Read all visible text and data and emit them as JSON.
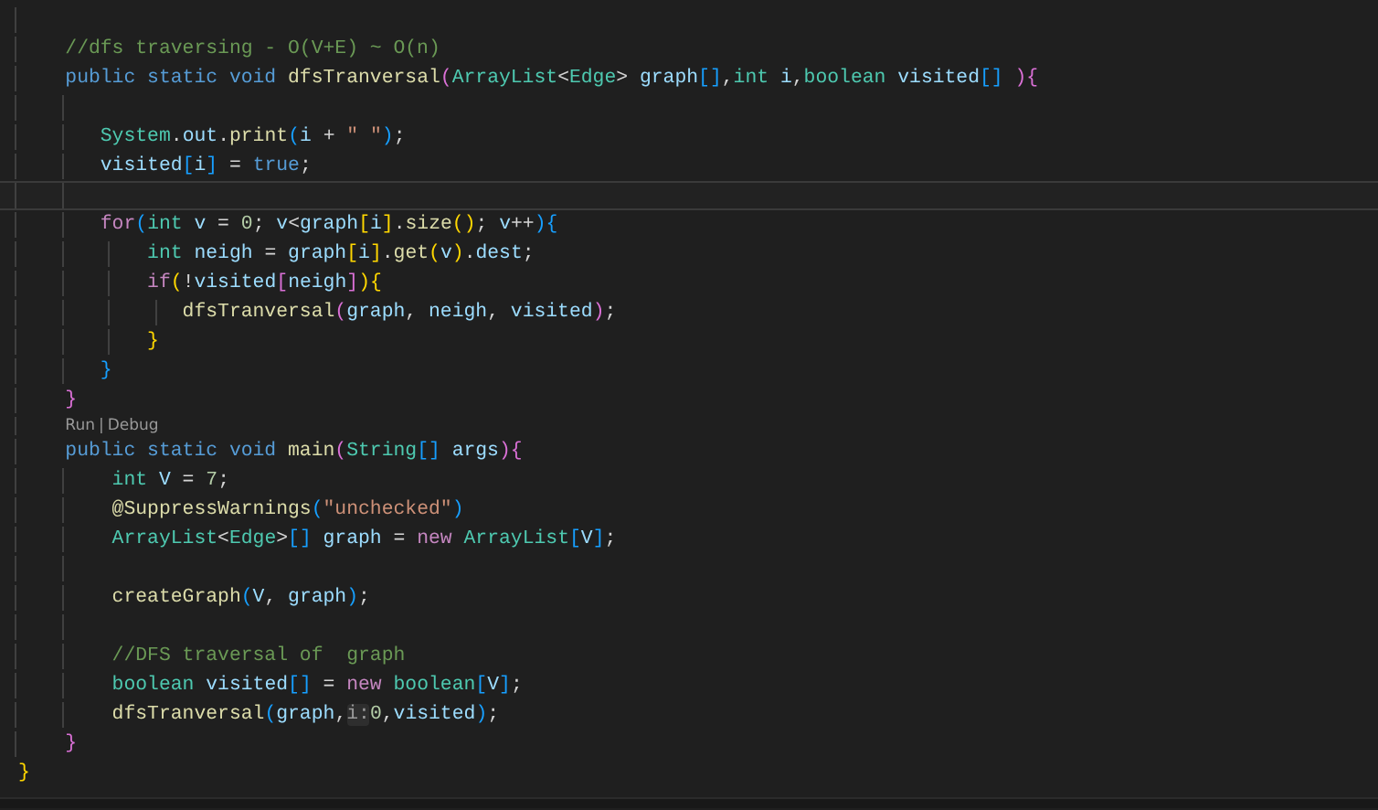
{
  "editor": {
    "lines": [
      {
        "kind": "blank",
        "current": false
      },
      {
        "kind": "code",
        "current": false,
        "tokens": [
          {
            "text": "    //dfs traversing - O(V+E) ~ O(n)",
            "kind": "com"
          }
        ]
      },
      {
        "kind": "code",
        "current": false,
        "tokens": [
          {
            "text": "    public static void ",
            "kind": "kw"
          },
          {
            "text": "dfsTranversal",
            "kind": "fn"
          },
          {
            "text": "(",
            "kind": "b2"
          },
          {
            "text": "ArrayList",
            "kind": "type"
          },
          {
            "text": "<",
            "kind": "p"
          },
          {
            "text": "Edge",
            "kind": "type"
          },
          {
            "text": ">",
            "kind": "p"
          },
          {
            "text": " graph",
            "kind": "var"
          },
          {
            "text": "[]",
            "kind": "b3"
          },
          {
            "text": ",",
            "kind": "p"
          },
          {
            "text": "int",
            "kind": "type"
          },
          {
            "text": " i",
            "kind": "var"
          },
          {
            "text": ",",
            "kind": "p"
          },
          {
            "text": "boolean",
            "kind": "type"
          },
          {
            "text": " visited",
            "kind": "var"
          },
          {
            "text": "[]",
            "kind": "b3"
          },
          {
            "text": " ){",
            "kind": "b2"
          }
        ]
      },
      {
        "kind": "blank",
        "current": false
      },
      {
        "kind": "code",
        "current": false,
        "tokens": [
          {
            "text": "       System",
            "kind": "type"
          },
          {
            "text": ".",
            "kind": "p"
          },
          {
            "text": "out",
            "kind": "var"
          },
          {
            "text": ".",
            "kind": "p"
          },
          {
            "text": "print",
            "kind": "fn"
          },
          {
            "text": "(",
            "kind": "b3"
          },
          {
            "text": "i",
            "kind": "var"
          },
          {
            "text": " + ",
            "kind": "p"
          },
          {
            "text": "\" \"",
            "kind": "str"
          },
          {
            "text": ")",
            "kind": "b3"
          },
          {
            "text": ";",
            "kind": "p"
          }
        ]
      },
      {
        "kind": "code",
        "current": false,
        "tokens": [
          {
            "text": "       visited",
            "kind": "var"
          },
          {
            "text": "[",
            "kind": "b3"
          },
          {
            "text": "i",
            "kind": "var"
          },
          {
            "text": "]",
            "kind": "b3"
          },
          {
            "text": " = ",
            "kind": "p"
          },
          {
            "text": "true",
            "kind": "kw"
          },
          {
            "text": ";",
            "kind": "p"
          }
        ]
      },
      {
        "kind": "blank",
        "current": true
      },
      {
        "kind": "code",
        "current": false,
        "tokens": [
          {
            "text": "       for",
            "kind": "ctl"
          },
          {
            "text": "(",
            "kind": "b3"
          },
          {
            "text": "int",
            "kind": "type"
          },
          {
            "text": " v",
            "kind": "var"
          },
          {
            "text": " = ",
            "kind": "p"
          },
          {
            "text": "0",
            "kind": "num"
          },
          {
            "text": "; ",
            "kind": "p"
          },
          {
            "text": "v",
            "kind": "var"
          },
          {
            "text": "<",
            "kind": "p"
          },
          {
            "text": "graph",
            "kind": "var"
          },
          {
            "text": "[",
            "kind": "b1"
          },
          {
            "text": "i",
            "kind": "var"
          },
          {
            "text": "]",
            "kind": "b1"
          },
          {
            "text": ".",
            "kind": "p"
          },
          {
            "text": "size",
            "kind": "fn"
          },
          {
            "text": "()",
            "kind": "b1"
          },
          {
            "text": "; ",
            "kind": "p"
          },
          {
            "text": "v",
            "kind": "var"
          },
          {
            "text": "++",
            "kind": "p"
          },
          {
            "text": "){",
            "kind": "b3"
          }
        ]
      },
      {
        "kind": "code",
        "current": false,
        "tokens": [
          {
            "text": "           int",
            "kind": "type"
          },
          {
            "text": " neigh",
            "kind": "var"
          },
          {
            "text": " = ",
            "kind": "p"
          },
          {
            "text": "graph",
            "kind": "var"
          },
          {
            "text": "[",
            "kind": "b1"
          },
          {
            "text": "i",
            "kind": "var"
          },
          {
            "text": "]",
            "kind": "b1"
          },
          {
            "text": ".",
            "kind": "p"
          },
          {
            "text": "get",
            "kind": "fn"
          },
          {
            "text": "(",
            "kind": "b1"
          },
          {
            "text": "v",
            "kind": "var"
          },
          {
            "text": ")",
            "kind": "b1"
          },
          {
            "text": ".",
            "kind": "p"
          },
          {
            "text": "dest",
            "kind": "var"
          },
          {
            "text": ";",
            "kind": "p"
          }
        ]
      },
      {
        "kind": "code",
        "current": false,
        "tokens": [
          {
            "text": "           if",
            "kind": "ctl"
          },
          {
            "text": "(",
            "kind": "b1"
          },
          {
            "text": "!",
            "kind": "p"
          },
          {
            "text": "visited",
            "kind": "var"
          },
          {
            "text": "[",
            "kind": "b2"
          },
          {
            "text": "neigh",
            "kind": "var"
          },
          {
            "text": "]",
            "kind": "b2"
          },
          {
            "text": "){",
            "kind": "b1"
          }
        ]
      },
      {
        "kind": "code",
        "current": false,
        "tokens": [
          {
            "text": "              dfsTranversal",
            "kind": "fn"
          },
          {
            "text": "(",
            "kind": "b2"
          },
          {
            "text": "graph",
            "kind": "var"
          },
          {
            "text": ", ",
            "kind": "p"
          },
          {
            "text": "neigh",
            "kind": "var"
          },
          {
            "text": ", ",
            "kind": "p"
          },
          {
            "text": "visited",
            "kind": "var"
          },
          {
            "text": ")",
            "kind": "b2"
          },
          {
            "text": ";",
            "kind": "p"
          }
        ]
      },
      {
        "kind": "code",
        "current": false,
        "tokens": [
          {
            "text": "           }",
            "kind": "b1"
          }
        ]
      },
      {
        "kind": "code",
        "current": false,
        "tokens": [
          {
            "text": "       }",
            "kind": "b3"
          }
        ]
      },
      {
        "kind": "code",
        "current": false,
        "tokens": [
          {
            "text": "    }",
            "kind": "b2"
          }
        ]
      },
      {
        "kind": "codelens",
        "current": false,
        "actions": [
          "Run",
          "Debug"
        ],
        "separator": "|"
      },
      {
        "kind": "code",
        "current": false,
        "tokens": [
          {
            "text": "    public static void ",
            "kind": "kw"
          },
          {
            "text": "main",
            "kind": "fn"
          },
          {
            "text": "(",
            "kind": "b2"
          },
          {
            "text": "String",
            "kind": "type"
          },
          {
            "text": "[]",
            "kind": "b3"
          },
          {
            "text": " args",
            "kind": "var"
          },
          {
            "text": "){",
            "kind": "b2"
          }
        ]
      },
      {
        "kind": "code",
        "current": false,
        "tokens": [
          {
            "text": "        int",
            "kind": "type"
          },
          {
            "text": " V",
            "kind": "var"
          },
          {
            "text": " = ",
            "kind": "p"
          },
          {
            "text": "7",
            "kind": "num"
          },
          {
            "text": ";",
            "kind": "p"
          }
        ]
      },
      {
        "kind": "code",
        "current": false,
        "tokens": [
          {
            "text": "        @SuppressWarnings",
            "kind": "fn"
          },
          {
            "text": "(",
            "kind": "b3"
          },
          {
            "text": "\"unchecked\"",
            "kind": "str"
          },
          {
            "text": ")",
            "kind": "b3"
          }
        ]
      },
      {
        "kind": "code",
        "current": false,
        "tokens": [
          {
            "text": "        ArrayList",
            "kind": "type"
          },
          {
            "text": "<",
            "kind": "p"
          },
          {
            "text": "Edge",
            "kind": "type"
          },
          {
            "text": ">",
            "kind": "p"
          },
          {
            "text": "[]",
            "kind": "b3"
          },
          {
            "text": " graph",
            "kind": "var"
          },
          {
            "text": " = ",
            "kind": "p"
          },
          {
            "text": "new",
            "kind": "ctl"
          },
          {
            "text": " ArrayList",
            "kind": "type"
          },
          {
            "text": "[",
            "kind": "b3"
          },
          {
            "text": "V",
            "kind": "var"
          },
          {
            "text": "]",
            "kind": "b3"
          },
          {
            "text": ";",
            "kind": "p"
          }
        ]
      },
      {
        "kind": "blank",
        "current": false
      },
      {
        "kind": "code",
        "current": false,
        "tokens": [
          {
            "text": "        createGraph",
            "kind": "fn"
          },
          {
            "text": "(",
            "kind": "b3"
          },
          {
            "text": "V",
            "kind": "var"
          },
          {
            "text": ", ",
            "kind": "p"
          },
          {
            "text": "graph",
            "kind": "var"
          },
          {
            "text": ")",
            "kind": "b3"
          },
          {
            "text": ";",
            "kind": "p"
          }
        ]
      },
      {
        "kind": "blank",
        "current": false
      },
      {
        "kind": "code",
        "current": false,
        "tokens": [
          {
            "text": "        //DFS traversal of  graph",
            "kind": "com"
          }
        ]
      },
      {
        "kind": "code",
        "current": false,
        "tokens": [
          {
            "text": "        boolean",
            "kind": "type"
          },
          {
            "text": " visited",
            "kind": "var"
          },
          {
            "text": "[]",
            "kind": "b3"
          },
          {
            "text": " = ",
            "kind": "p"
          },
          {
            "text": "new",
            "kind": "ctl"
          },
          {
            "text": " boolean",
            "kind": "type"
          },
          {
            "text": "[",
            "kind": "b3"
          },
          {
            "text": "V",
            "kind": "var"
          },
          {
            "text": "]",
            "kind": "b3"
          },
          {
            "text": ";",
            "kind": "p"
          }
        ]
      },
      {
        "kind": "code",
        "current": false,
        "tokens": [
          {
            "text": "        dfsTranversal",
            "kind": "fn"
          },
          {
            "text": "(",
            "kind": "b3"
          },
          {
            "text": "graph",
            "kind": "var"
          },
          {
            "text": ",",
            "kind": "p"
          },
          {
            "text": "i:",
            "kind": "hint"
          },
          {
            "text": "0",
            "kind": "num"
          },
          {
            "text": ",",
            "kind": "p"
          },
          {
            "text": "visited",
            "kind": "var"
          },
          {
            "text": ")",
            "kind": "b3"
          },
          {
            "text": ";",
            "kind": "p"
          }
        ]
      },
      {
        "kind": "code",
        "current": false,
        "tokens": [
          {
            "text": "    }",
            "kind": "b2"
          }
        ]
      },
      {
        "kind": "code",
        "current": false,
        "tokens": [
          {
            "text": "}",
            "kind": "b1"
          }
        ]
      }
    ]
  }
}
